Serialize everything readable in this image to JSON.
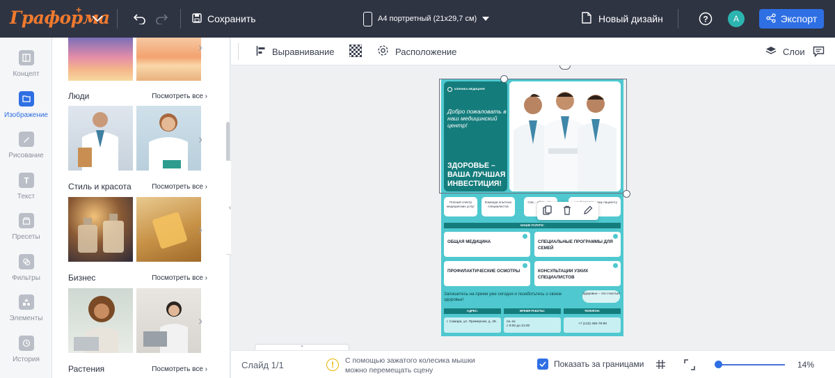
{
  "header": {
    "logo": "Граформа",
    "save_label": "Сохранить",
    "doc_size": "А4 портретный (21x29,7 см)",
    "new_design": "Новый дизайн",
    "avatar_letter": "A",
    "export_label": "Экспорт"
  },
  "rail": [
    {
      "label": "Концепт",
      "icon": "concept-icon"
    },
    {
      "label": "Изображение",
      "icon": "image-icon",
      "active": true
    },
    {
      "label": "Рисование",
      "icon": "draw-icon"
    },
    {
      "label": "Текст",
      "icon": "text-icon"
    },
    {
      "label": "Пресеты",
      "icon": "presets-icon"
    },
    {
      "label": "Фильтры",
      "icon": "filters-icon"
    },
    {
      "label": "Элементы",
      "icon": "elements-icon"
    },
    {
      "label": "История",
      "icon": "history-icon"
    }
  ],
  "panel": {
    "categories": [
      {
        "title": "Люди",
        "see_all": "Посмотреть все"
      },
      {
        "title": "Стиль и красота",
        "see_all": "Посмотреть все"
      },
      {
        "title": "Бизнес",
        "see_all": "Посмотреть все"
      },
      {
        "title": "Растения",
        "see_all": "Посмотреть все"
      }
    ]
  },
  "toolbar": {
    "align": "Выравнивание",
    "arrange": "Расположение",
    "layers": "Слои"
  },
  "poster": {
    "brand": "КЛИНИКА МЕДИЦИНЯ",
    "welcome": "Добро пожаловать в наш медицинский центр!",
    "slogan": "ЗДОРОВЬЕ – ВАША ЛУЧШАЯ ИНВЕСТИЦИЯ!",
    "features": [
      "Полный спектр медицинских услуг",
      "Команда опытных специалистов",
      "Современное оборудование",
      "Индивидуальный подход к каждому пациенту"
    ],
    "features_visible": [
      "Полный спектр медицинских услуг",
      "Команда опытных специалистов",
      "Сов... обор... те...",
      "...ьный подход ...ому пациенту"
    ],
    "services_band": "НАШИ УСЛУГИ:",
    "services": [
      "ОБЩАЯ МЕДИЦИНА",
      "СПЕЦИАЛЬНЫЕ ПРОГРАММЫ ДЛЯ СЕМЕЙ",
      "ПРОФИЛАКТИЧЕСКИЕ ОСМОТРЫ",
      "КОНСУЛЬТАЦИИ УЗКИХ СПЕЦИАЛИСТОВ"
    ],
    "cta": "Запишитесь на прием уже сегодня и позаботьтесь о своем здоровье!",
    "pill": "Здоровье – это счастье!",
    "contacts": [
      {
        "head": "АДРЕС:",
        "value": "г. Самара, ул. Примерная, д. 48."
      },
      {
        "head": "ВРЕМЯ РАБОТЫ:",
        "value": "пн.-вс\nс 9:00 до 21:00"
      },
      {
        "head": "ТЕЛЕФОН:",
        "value": "+7 (123) 456-78-90"
      }
    ]
  },
  "bottom": {
    "slide": "Слайд 1/1",
    "hint": "С помощью зажатого колесика мышки можно перемещать сцену",
    "show_bounds": "Показать за границами",
    "show_bounds_checked": true,
    "zoom_percent": 14,
    "zoom_label": "14%"
  }
}
